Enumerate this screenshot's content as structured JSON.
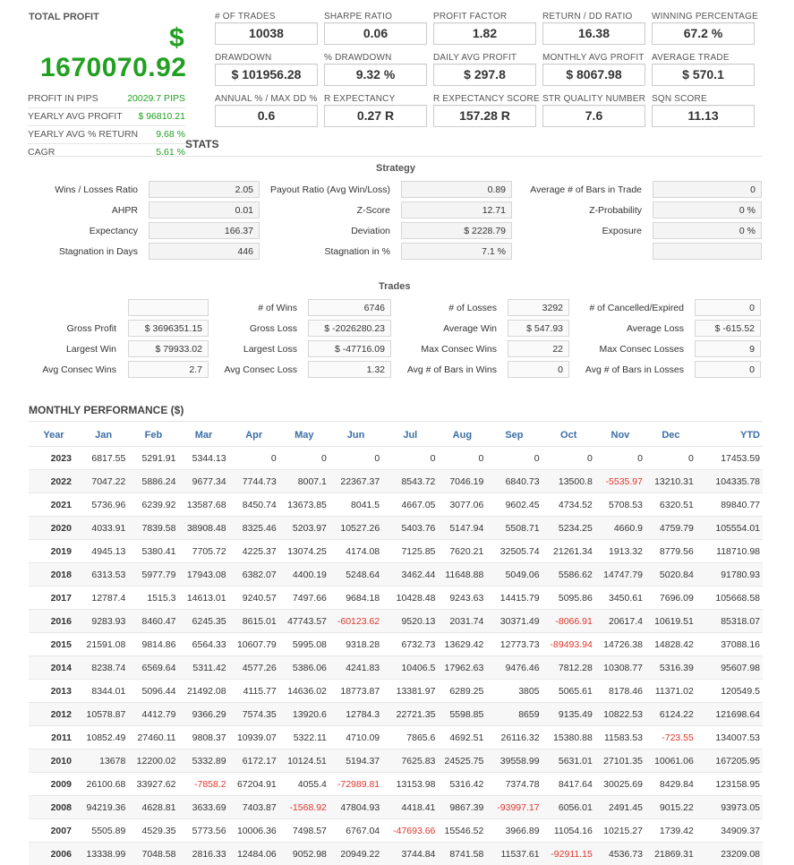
{
  "total_profit": {
    "label": "TOTAL PROFIT",
    "currency_symbol": "$",
    "value": "1670070.92",
    "color": "#22a022"
  },
  "side_stats": [
    {
      "label": "PROFIT IN PIPS",
      "value": "20029.7 PIPS"
    },
    {
      "label": "YEARLY AVG PROFIT",
      "value": "$ 96810.21"
    },
    {
      "label": "YEARLY AVG % RETURN",
      "value": "9.68 %"
    },
    {
      "label": "CAGR",
      "value": "5.61 %"
    }
  ],
  "metrics": [
    [
      {
        "label": "# OF TRADES",
        "value": "10038"
      },
      {
        "label": "SHARPE RATIO",
        "value": "0.06"
      },
      {
        "label": "PROFIT FACTOR",
        "value": "1.82"
      },
      {
        "label": "RETURN / DD RATIO",
        "value": "16.38"
      },
      {
        "label": "WINNING PERCENTAGE",
        "value": "67.2 %"
      }
    ],
    [
      {
        "label": "DRAWDOWN",
        "value": "$ 101956.28"
      },
      {
        "label": "% DRAWDOWN",
        "value": "9.32 %"
      },
      {
        "label": "DAILY AVG PROFIT",
        "value": "$ 297.8"
      },
      {
        "label": "MONTHLY AVG PROFIT",
        "value": "$ 8067.98"
      },
      {
        "label": "AVERAGE TRADE",
        "value": "$ 570.1"
      }
    ],
    [
      {
        "label": "ANNUAL % / MAX DD %",
        "value": "0.6"
      },
      {
        "label": "R EXPECTANCY",
        "value": "0.27 R"
      },
      {
        "label": "R EXPECTANCY SCORE",
        "value": "157.28 R"
      },
      {
        "label": "STR QUALITY NUMBER",
        "value": "7.6"
      },
      {
        "label": "SQN SCORE",
        "value": "11.13"
      }
    ]
  ],
  "stats_title": "STATS",
  "strategy": {
    "title": "Strategy",
    "rows": [
      [
        {
          "label": "Wins / Losses Ratio",
          "value": "2.05"
        },
        {
          "label": "Payout Ratio (Avg Win/Loss)",
          "value": "0.89"
        },
        {
          "label": "Average # of Bars in Trade",
          "value": "0"
        }
      ],
      [
        {
          "label": "AHPR",
          "value": "0.01"
        },
        {
          "label": "Z-Score",
          "value": "12.71"
        },
        {
          "label": "Z-Probability",
          "value": "0 %"
        }
      ],
      [
        {
          "label": "Expectancy",
          "value": "166.37"
        },
        {
          "label": "Deviation",
          "value": "$ 2228.79"
        },
        {
          "label": "Exposure",
          "value": "0 %"
        }
      ],
      [
        {
          "label": "Stagnation in Days",
          "value": "446"
        },
        {
          "label": "Stagnation in %",
          "value": "7.1 %"
        },
        {
          "label": "",
          "value": ""
        }
      ]
    ]
  },
  "trades": {
    "title": "Trades",
    "rows": [
      [
        {
          "label": "",
          "value": ""
        },
        {
          "label": "# of Wins",
          "value": "6746"
        },
        {
          "label": "# of Losses",
          "value": "3292"
        },
        {
          "label": "# of Cancelled/Expired",
          "value": "0"
        }
      ],
      [
        {
          "label": "Gross Profit",
          "value": "$ 3696351.15"
        },
        {
          "label": "Gross Loss",
          "value": "$ -2026280.23"
        },
        {
          "label": "Average Win",
          "value": "$ 547.93"
        },
        {
          "label": "Average Loss",
          "value": "$ -615.52"
        }
      ],
      [
        {
          "label": "Largest Win",
          "value": "$ 79933.02"
        },
        {
          "label": "Largest Loss",
          "value": "$ -47716.09"
        },
        {
          "label": "Max Consec Wins",
          "value": "22"
        },
        {
          "label": "Max Consec Losses",
          "value": "9"
        }
      ],
      [
        {
          "label": "Avg Consec Wins",
          "value": "2.7"
        },
        {
          "label": "Avg Consec Loss",
          "value": "1.32"
        },
        {
          "label": "Avg # of Bars in Wins",
          "value": "0"
        },
        {
          "label": "Avg # of Bars in Losses",
          "value": "0"
        }
      ]
    ]
  },
  "monthly": {
    "title": "MONTHLY PERFORMANCE ($)",
    "headers": [
      "Year",
      "Jan",
      "Feb",
      "Mar",
      "Apr",
      "May",
      "Jun",
      "Jul",
      "Aug",
      "Sep",
      "Oct",
      "Nov",
      "Dec",
      "YTD"
    ],
    "rows": [
      [
        "2023",
        "6817.55",
        "5291.91",
        "5344.13",
        "0",
        "0",
        "0",
        "0",
        "0",
        "0",
        "0",
        "0",
        "0",
        "17453.59"
      ],
      [
        "2022",
        "7047.22",
        "5886.24",
        "9677.34",
        "7744.73",
        "8007.1",
        "22367.37",
        "8543.72",
        "7046.19",
        "6840.73",
        "13500.8",
        "-5535.97",
        "13210.31",
        "104335.78"
      ],
      [
        "2021",
        "5736.96",
        "6239.92",
        "13587.68",
        "8450.74",
        "13673.85",
        "8041.5",
        "4667.05",
        "3077.06",
        "9602.45",
        "4734.52",
        "5708.53",
        "6320.51",
        "89840.77"
      ],
      [
        "2020",
        "4033.91",
        "7839.58",
        "38908.48",
        "8325.46",
        "5203.97",
        "10527.26",
        "5403.76",
        "5147.94",
        "5508.71",
        "5234.25",
        "4660.9",
        "4759.79",
        "105554.01"
      ],
      [
        "2019",
        "4945.13",
        "5380.41",
        "7705.72",
        "4225.37",
        "13074.25",
        "4174.08",
        "7125.85",
        "7620.21",
        "32505.74",
        "21261.34",
        "1913.32",
        "8779.56",
        "118710.98"
      ],
      [
        "2018",
        "6313.53",
        "5977.79",
        "17943.08",
        "6382.07",
        "4400.19",
        "5248.64",
        "3462.44",
        "11648.88",
        "5049.06",
        "5586.62",
        "14747.79",
        "5020.84",
        "91780.93"
      ],
      [
        "2017",
        "12787.4",
        "1515.3",
        "14613.01",
        "9240.57",
        "7497.66",
        "9684.18",
        "10428.48",
        "9243.63",
        "14415.79",
        "5095.86",
        "3450.61",
        "7696.09",
        "105668.58"
      ],
      [
        "2016",
        "9283.93",
        "8460.47",
        "6245.35",
        "8615.01",
        "47743.57",
        "-60123.62",
        "9520.13",
        "2031.74",
        "30371.49",
        "-8066.91",
        "20617.4",
        "10619.51",
        "85318.07"
      ],
      [
        "2015",
        "21591.08",
        "9814.86",
        "6564.33",
        "10607.79",
        "5995.08",
        "9318.28",
        "6732.73",
        "13629.42",
        "12773.73",
        "-89493.94",
        "14726.38",
        "14828.42",
        "37088.16"
      ],
      [
        "2014",
        "8238.74",
        "6569.64",
        "5311.42",
        "4577.26",
        "5386.06",
        "4241.83",
        "10406.5",
        "17962.63",
        "9476.46",
        "7812.28",
        "10308.77",
        "5316.39",
        "95607.98"
      ],
      [
        "2013",
        "8344.01",
        "5096.44",
        "21492.08",
        "4115.77",
        "14636.02",
        "18773.87",
        "13381.97",
        "6289.25",
        "3805",
        "5065.61",
        "8178.46",
        "11371.02",
        "120549.5"
      ],
      [
        "2012",
        "10578.87",
        "4412.79",
        "9366.29",
        "7574.35",
        "13920.6",
        "12784.3",
        "22721.35",
        "5598.85",
        "8659",
        "9135.49",
        "10822.53",
        "6124.22",
        "121698.64"
      ],
      [
        "2011",
        "10852.49",
        "27460.11",
        "9808.37",
        "10939.07",
        "5322.11",
        "4710.09",
        "7865.6",
        "4692.51",
        "26116.32",
        "15380.88",
        "11583.53",
        "-723.55",
        "134007.53"
      ],
      [
        "2010",
        "13678",
        "12200.02",
        "5332.89",
        "6172.17",
        "10124.51",
        "5194.37",
        "7625.83",
        "24525.75",
        "39558.99",
        "5631.01",
        "27101.35",
        "10061.06",
        "167205.95"
      ],
      [
        "2009",
        "26100.68",
        "33927.62",
        "-7858.2",
        "67204.91",
        "4055.4",
        "-72989.81",
        "13153.98",
        "5316.42",
        "7374.78",
        "8417.64",
        "30025.69",
        "8429.84",
        "123158.95"
      ],
      [
        "2008",
        "94219.36",
        "4628.81",
        "3633.69",
        "7403.87",
        "-1568.92",
        "47804.93",
        "4418.41",
        "9867.39",
        "-93997.17",
        "6056.01",
        "2491.45",
        "9015.22",
        "93973.05"
      ],
      [
        "2007",
        "5505.89",
        "4529.35",
        "5773.56",
        "10006.36",
        "7498.57",
        "6767.04",
        "-47693.66",
        "15546.52",
        "3966.89",
        "11054.16",
        "10215.27",
        "1739.42",
        "34909.37"
      ],
      [
        "2006",
        "13338.99",
        "7048.58",
        "2816.33",
        "12484.06",
        "9052.98",
        "20949.22",
        "3744.84",
        "8741.58",
        "11537.61",
        "-92911.15",
        "4536.73",
        "21869.31",
        "23209.08"
      ]
    ]
  },
  "colors": {
    "positive": "#22a022",
    "negative": "#e0352b",
    "header_blue": "#3a6ea5"
  }
}
